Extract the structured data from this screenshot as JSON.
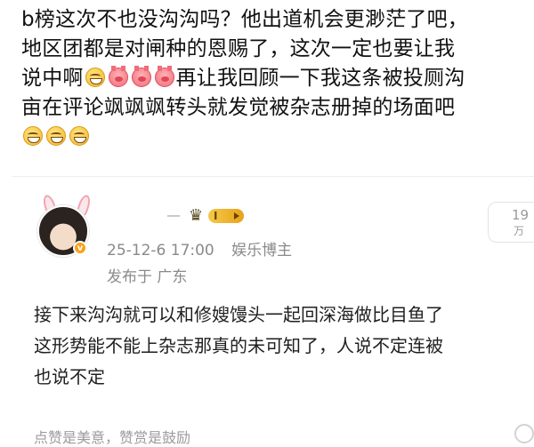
{
  "post": {
    "lines": [
      "b榜这次不也没沟沟吗？他出道机会更渺茫了吧，",
      "地区团都是对闸种的恩赐了，这次一定也要让我",
      "说中啊",
      "再让我回顾一下我这条被投厕沟",
      "亩在评论飒飒飒转头就发觉被杂志册掉的场面吧"
    ],
    "emoji": {
      "grin": "grin-face-icon",
      "pig": "pig-face-icon"
    }
  },
  "comment": {
    "level_label": "I",
    "like_count": "19",
    "like_sub": "万",
    "date": "25-12-6 17:00",
    "role": "娱乐博主",
    "location": "发布于 广东",
    "lines": [
      "接下来沟沟就可以和修嫂馒头一起回深海做比目鱼了",
      "这形势能不能上杂志那真的未可知了，人说不定连被",
      "也说不定"
    ],
    "footer": "点赞是美意，赞赏是鼓励",
    "verified_mark": "v"
  },
  "colors": {
    "text": "#111111",
    "meta": "#8a8a8a",
    "badge": "#e8a21a"
  }
}
